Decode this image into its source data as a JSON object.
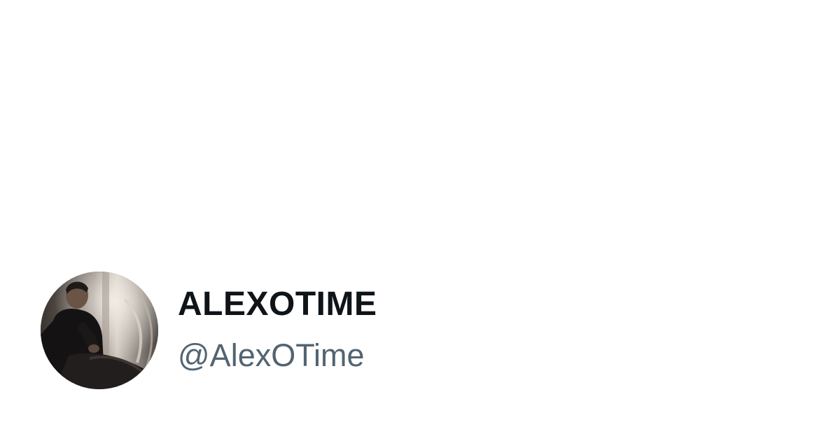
{
  "profile": {
    "display_name": "ALEXOTIME",
    "handle": "@AlexOTime",
    "avatar_icon": "profile-photo",
    "name_color": "#0f1419",
    "handle_color": "#536471"
  }
}
